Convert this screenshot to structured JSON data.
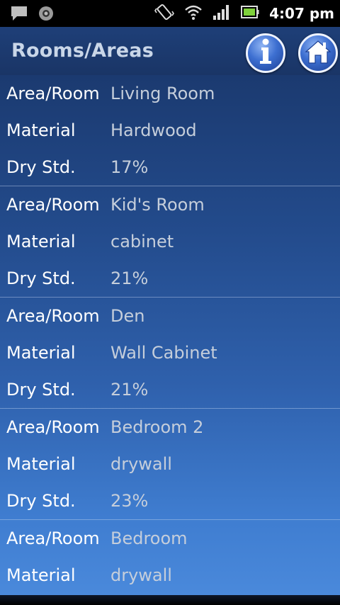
{
  "status_bar": {
    "time": "4:07 pm"
  },
  "header": {
    "title": "Rooms/Areas"
  },
  "labels": {
    "area_room": "Area/Room",
    "material": "Material",
    "dry_std": "Dry Std."
  },
  "records": [
    {
      "area_room": "Living Room",
      "material": "Hardwood",
      "dry_std": "17%"
    },
    {
      "area_room": "Kid's Room",
      "material": "cabinet",
      "dry_std": "21%"
    },
    {
      "area_room": "Den",
      "material": "Wall Cabinet",
      "dry_std": "21%"
    },
    {
      "area_room": "Bedroom 2",
      "material": "drywall",
      "dry_std": "23%"
    },
    {
      "area_room": "Bedroom",
      "material": "drywall"
    }
  ],
  "colors": {
    "header_bg": "#1e3f78",
    "title_text": "#c9d6e8",
    "label_text": "#ffffff",
    "value_text": "#c5cedb",
    "button_blue": "#3d6fd1"
  },
  "icons": {
    "info": "info-icon",
    "home": "home-icon"
  }
}
